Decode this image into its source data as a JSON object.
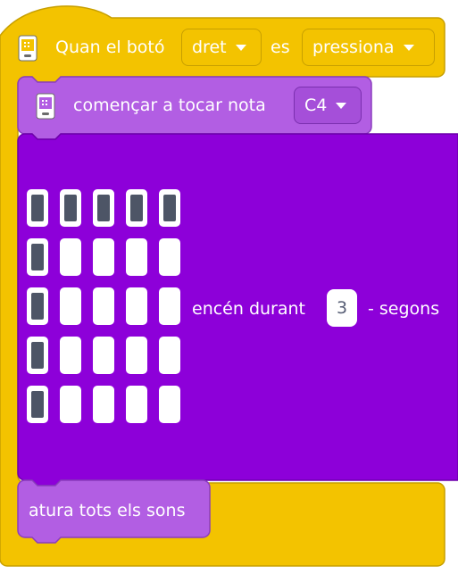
{
  "hat": {
    "text_before": "Quan el botó",
    "button_dropdown": "dret",
    "text_middle": "es",
    "state_dropdown": "pressiona",
    "icon": "hub-icon"
  },
  "play_block": {
    "label": "començar a tocar nota",
    "note_dropdown": "C4",
    "icon": "hub-icon"
  },
  "light_block": {
    "label": "encén durant",
    "seconds_value": "3",
    "suffix": "- segons",
    "matrix": [
      [
        1,
        1,
        1,
        1,
        1
      ],
      [
        1,
        0,
        0,
        0,
        0
      ],
      [
        1,
        0,
        0,
        0,
        0
      ],
      [
        1,
        0,
        0,
        0,
        0
      ],
      [
        1,
        0,
        0,
        0,
        0
      ]
    ]
  },
  "stop_block": {
    "label": "atura tots els sons"
  },
  "colors": {
    "events_yellow": "#f3c300",
    "sound_lilac": "#b25ee3",
    "light_purple": "#8d00d9"
  }
}
